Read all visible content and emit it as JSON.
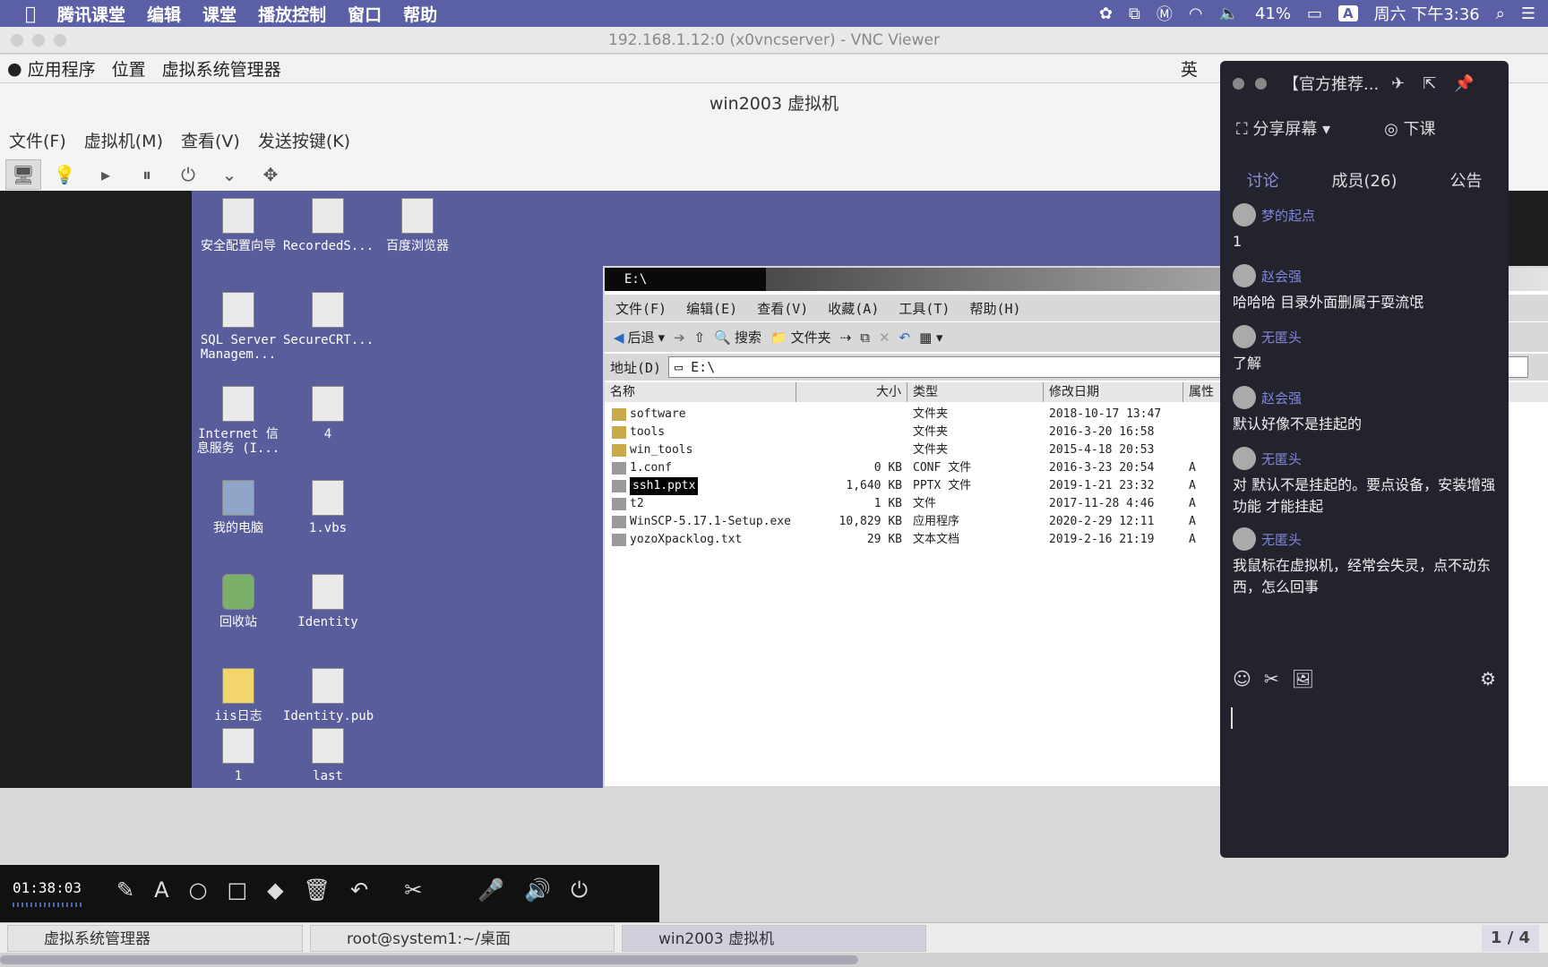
{
  "mac_menu": {
    "apple": "",
    "items": [
      "腾讯课堂",
      "编辑",
      "课堂",
      "播放控制",
      "窗口",
      "帮助"
    ],
    "battery": "41%",
    "input_badge": "A",
    "clock": "周六 下午3:36"
  },
  "vnc": {
    "title": "192.168.1.12:0 (x0vncserver) - VNC Viewer"
  },
  "gnome_panel": {
    "items": [
      "应用程序",
      "位置",
      "虚拟系统管理器"
    ],
    "ime": "英"
  },
  "virt_manager": {
    "title": "win2003 虚拟机",
    "menu": [
      "文件(F)",
      "虚拟机(M)",
      "查看(V)",
      "发送按键(K)"
    ]
  },
  "desktop_icons": [
    {
      "label": "安全配置向导",
      "kind": "file"
    },
    {
      "label": "RecordedS...",
      "kind": "file"
    },
    {
      "label": "百度浏览器",
      "kind": "file"
    },
    {
      "label": "SQL Server Managem...",
      "kind": "file"
    },
    {
      "label": "SecureCRT...",
      "kind": "file"
    },
    {
      "label": "Internet 信息服务 (I...",
      "kind": "file"
    },
    {
      "label": "4",
      "kind": "file"
    },
    {
      "label": "我的电脑",
      "kind": "pc"
    },
    {
      "label": "1.vbs",
      "kind": "file"
    },
    {
      "label": "回收站",
      "kind": "bin"
    },
    {
      "label": "Identity",
      "kind": "file"
    },
    {
      "label": "iis日志",
      "kind": "folder"
    },
    {
      "label": "Identity.pub",
      "kind": "file"
    },
    {
      "label": "1",
      "kind": "file"
    },
    {
      "label": "last",
      "kind": "file"
    }
  ],
  "explorer": {
    "title": "E:\\",
    "menu": [
      "文件(F)",
      "编辑(E)",
      "查看(V)",
      "收藏(A)",
      "工具(T)",
      "帮助(H)"
    ],
    "toolbar": {
      "back": "后退",
      "search": "搜索",
      "folders": "文件夹"
    },
    "address_label": "地址(D)",
    "address_value": "E:\\",
    "columns": [
      "名称",
      "大小",
      "类型",
      "修改日期",
      "属性"
    ],
    "rows": [
      {
        "name": "software",
        "size": "",
        "type": "文件夹",
        "date": "2018-10-17 13:47",
        "attr": "",
        "folder": true
      },
      {
        "name": "tools",
        "size": "",
        "type": "文件夹",
        "date": "2016-3-20 16:58",
        "attr": "",
        "folder": true
      },
      {
        "name": "win_tools",
        "size": "",
        "type": "文件夹",
        "date": "2015-4-18 20:53",
        "attr": "",
        "folder": true
      },
      {
        "name": "1.conf",
        "size": "0 KB",
        "type": "CONF 文件",
        "date": "2016-3-23 20:54",
        "attr": "A",
        "folder": false
      },
      {
        "name": "ssh1.pptx",
        "size": "1,640 KB",
        "type": "PPTX 文件",
        "date": "2019-1-21 23:32",
        "attr": "A",
        "folder": false,
        "selected": true
      },
      {
        "name": "t2",
        "size": "1 KB",
        "type": "文件",
        "date": "2017-11-28 4:46",
        "attr": "A",
        "folder": false
      },
      {
        "name": "WinSCP-5.17.1-Setup.exe",
        "size": "10,829 KB",
        "type": "应用程序",
        "date": "2020-2-29 12:11",
        "attr": "A",
        "folder": false
      },
      {
        "name": "yozoXpacklog.txt",
        "size": "29 KB",
        "type": "文本文档",
        "date": "2019-2-16 21:19",
        "attr": "A",
        "folder": false
      }
    ]
  },
  "chat": {
    "header_title": "【官方推荐...",
    "share": "分享屏幕",
    "end_class": "下课",
    "tabs": [
      "讨论",
      "成员(26)",
      "公告"
    ],
    "messages": [
      {
        "user": "梦的起点",
        "text": "1"
      },
      {
        "user": "赵会强",
        "text": "哈哈哈 目录外面删属于耍流氓"
      },
      {
        "user": "无匿头",
        "text": "了解"
      },
      {
        "user": "赵会强",
        "text": "默认好像不是挂起的"
      },
      {
        "user": "无匿头",
        "text": "对 默认不是挂起的。要点设备，安装增强功能 才能挂起"
      },
      {
        "user": "无匿头",
        "text": "我鼠标在虚拟机，经常会失灵，点不动东西，怎么回事"
      }
    ]
  },
  "recorder": {
    "time": "01:38:03"
  },
  "taskbar": {
    "tasks": [
      "虚拟系统管理器",
      "root@system1:~/桌面",
      "win2003 虚拟机"
    ],
    "pager": "1 / 4"
  },
  "colors": {
    "mac_bar": "#5b5fa6",
    "desktop": "#5a5d9c",
    "chat_bg": "#23232e",
    "chat_accent": "#7f86d9"
  }
}
